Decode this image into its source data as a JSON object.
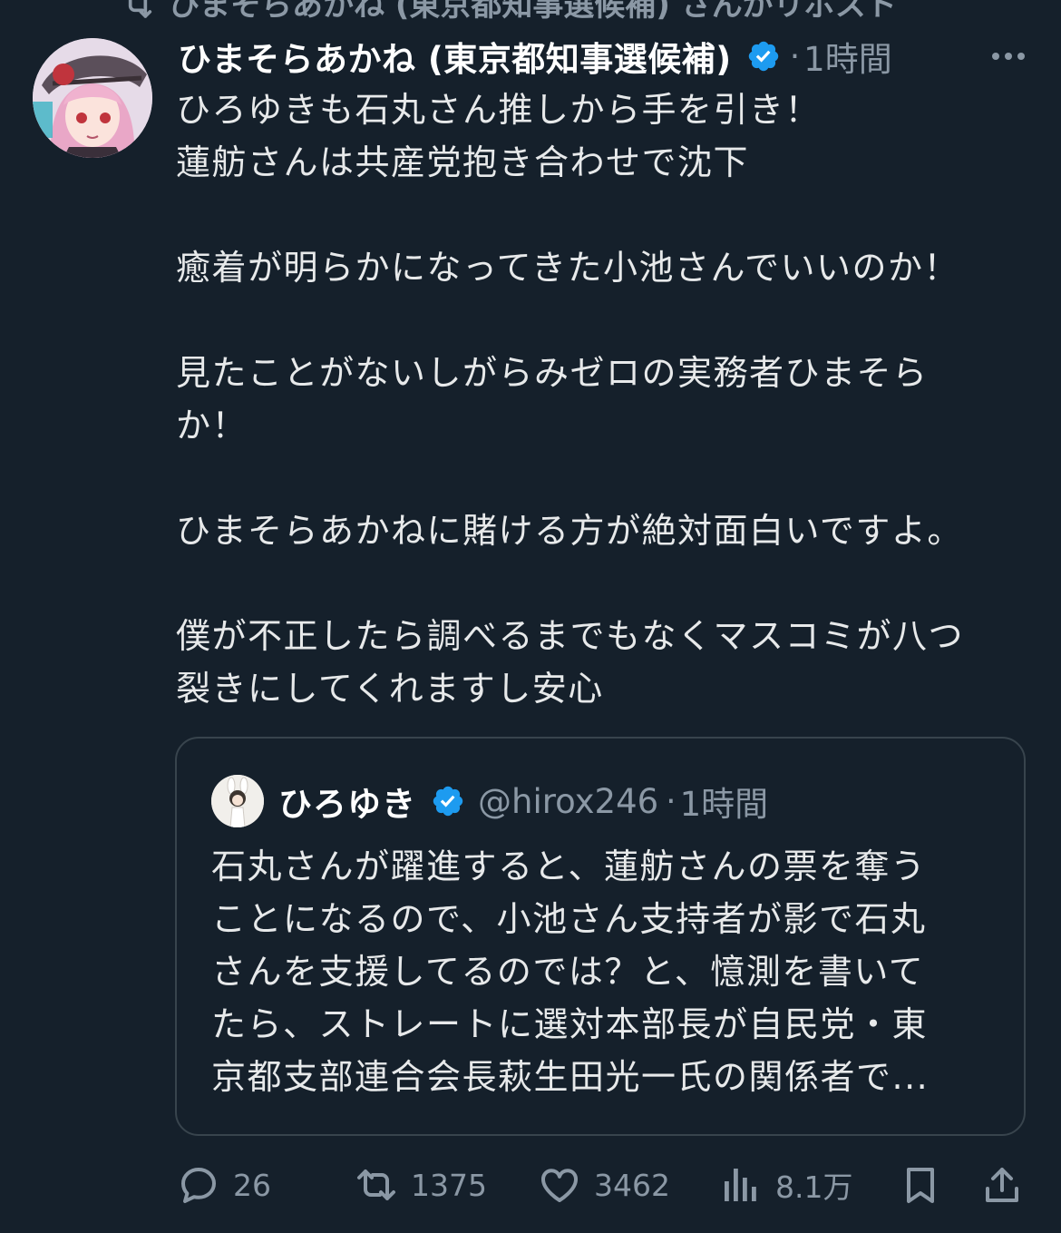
{
  "repost": {
    "text": "ひまそらあかね (東京都知事選候補) さんがリポスト"
  },
  "post": {
    "display_name": "ひまそらあかね (東京都知事選候補)",
    "separator": "·",
    "time": "1時間",
    "lines": [
      "ひろゆきも石丸さん推しから手を引き！",
      "蓮舫さんは共産党抱き合わせで沈下",
      "",
      "癒着が明らかになってきた小池さんでいいのか！",
      "",
      "見たことがないしがらみゼロの実務者ひまそら",
      "か！",
      "",
      "ひまそらあかねに賭ける方が絶対面白いですよ。",
      "",
      "僕が不正したら調べるまでもなくマスコミが八つ",
      "裂きにしてくれますし安心"
    ]
  },
  "quote": {
    "display_name": "ひろゆき",
    "handle": "@hirox246",
    "separator": "·",
    "time": "1時間",
    "lines": [
      "石丸さんが躍進すると、蓮舫さんの票を奪う",
      "ことになるので、小池さん支持者が影で石丸",
      "さんを支援してるのでは？と、憶測を書いて",
      "たら、ストレートに選対本部長が自民党・東",
      "京都支部連合会長萩生田光一氏の関係者で..."
    ]
  },
  "actions": {
    "replies": "26",
    "reposts": "1375",
    "likes": "3462",
    "views": "8.1万"
  },
  "colors": {
    "background": "#15202b",
    "text": "#e7e9ea",
    "secondary": "#8b98a5",
    "verified": "#1d9bf0",
    "border": "#38444d"
  },
  "icons": [
    "repost-icon",
    "verified-badge-icon",
    "more-icon",
    "reply-icon",
    "retweet-icon",
    "like-icon",
    "views-icon",
    "bookmark-icon",
    "share-icon"
  ]
}
